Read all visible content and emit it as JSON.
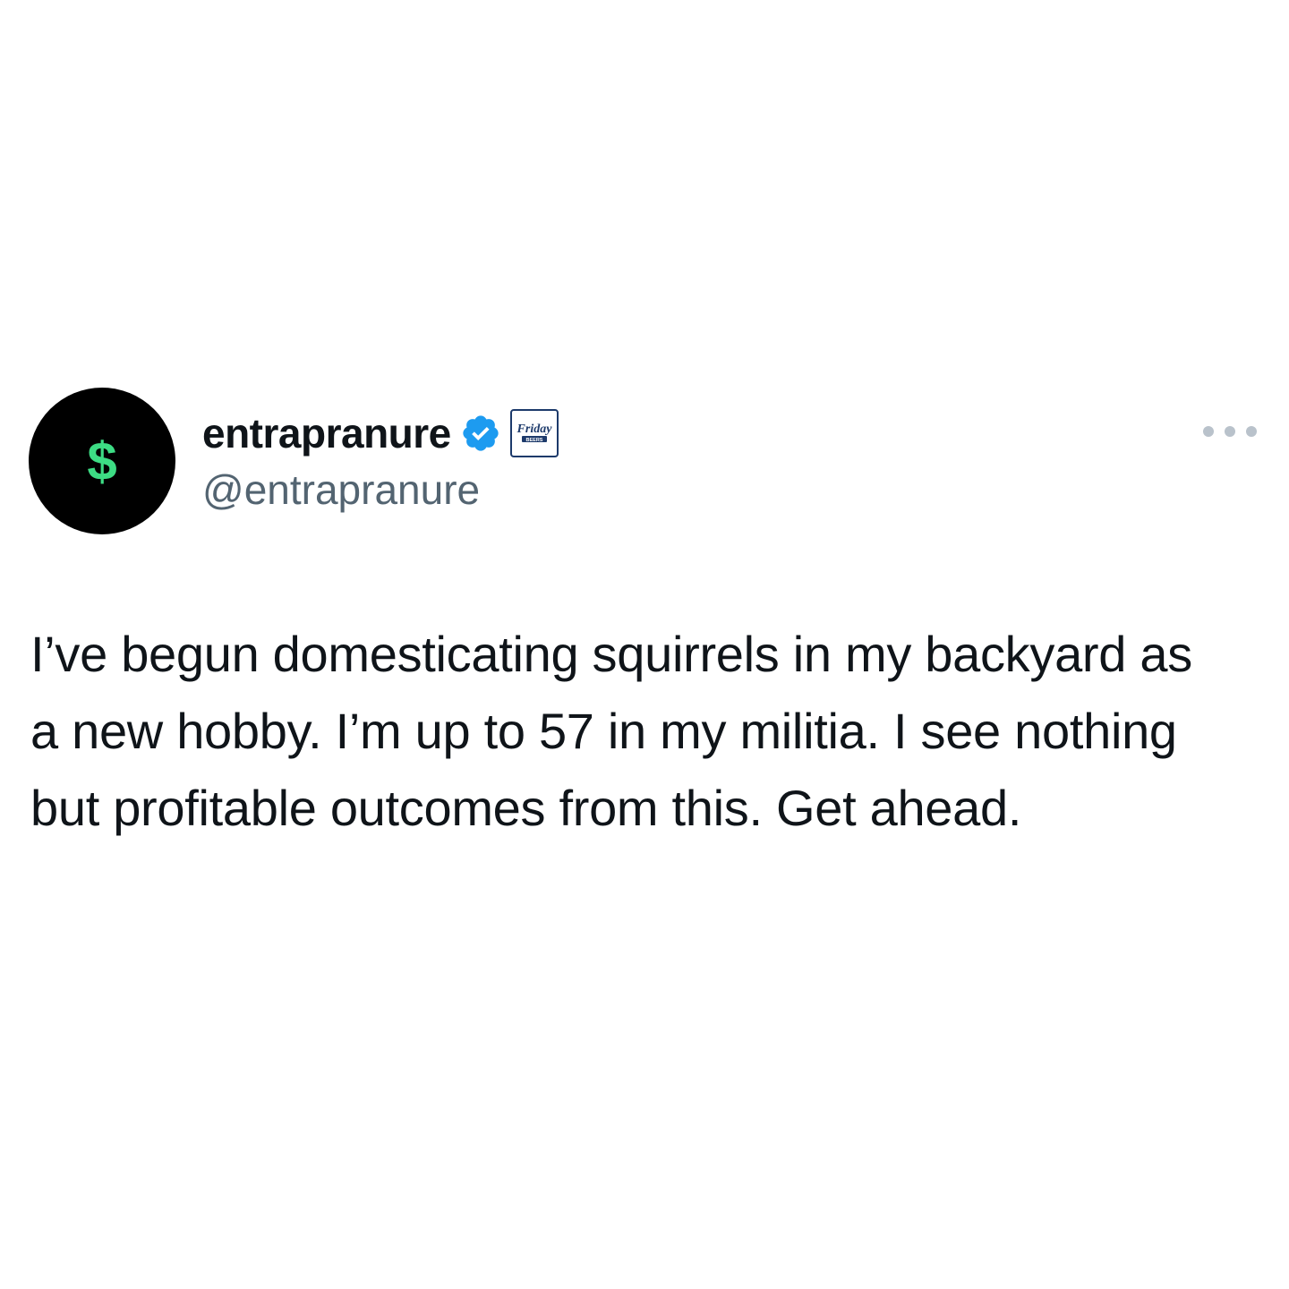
{
  "tweet": {
    "author": {
      "display_name": "entrapranure",
      "handle": "@entrapranure",
      "avatar_glyph": "$",
      "avatar_bg": "#000000",
      "avatar_glyph_color": "#3ddc84",
      "verified": true,
      "verified_icon": "verified-badge-icon",
      "affiliate_badge_text": "Friday BEERS"
    },
    "more_icon": "more-options-icon",
    "text": "I’ve begun domesticating squirrels in my backyard as a new hobby. I’m up to 57 in my militia. I see nothing but profitable outcomes from this. Get ahead.",
    "colors": {
      "text": "#0f1419",
      "handle": "#536471",
      "verified": "#1d9bf0"
    }
  }
}
